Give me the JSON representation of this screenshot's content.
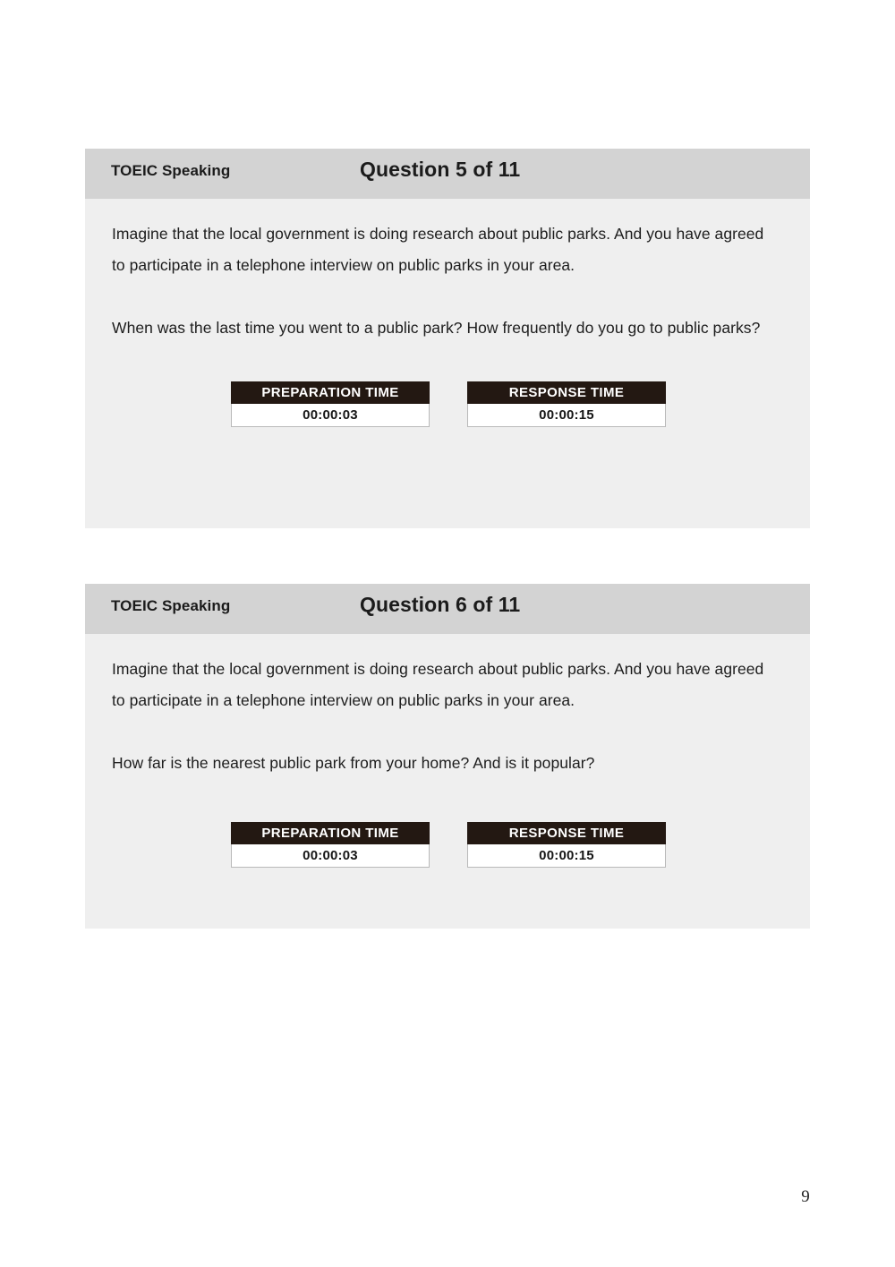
{
  "document": {
    "page_number": "9",
    "background_color": "#ffffff"
  },
  "theme": {
    "panel_background": "#efefef",
    "panel_header_background": "#d3d3d3",
    "timer_header_background": "#231812",
    "timer_value_background": "#ffffff",
    "text_color": "#1d1d1d"
  },
  "panels": [
    {
      "brand": "TOEIC Speaking",
      "title": "Question 5 of 11",
      "intro": "Imagine that the local government is doing research about public parks. And you have agreed to participate in a telephone interview on public parks in your area.",
      "question": "When was the last time you went to a public park? How frequently do you go to public parks?",
      "timers": [
        {
          "label": "PREPARATION TIME",
          "value": "00:00:03"
        },
        {
          "label": "RESPONSE TIME",
          "value": "00:00:15"
        }
      ]
    },
    {
      "brand": "TOEIC Speaking",
      "title": "Question 6 of 11",
      "intro": "Imagine that the local government is doing research about public parks. And you have agreed to participate in a telephone interview on public parks in your area.",
      "question": "How far is the nearest public park from your home? And is it popular?",
      "timers": [
        {
          "label": "PREPARATION TIME",
          "value": "00:00:03"
        },
        {
          "label": "RESPONSE TIME",
          "value": "00:00:15"
        }
      ]
    }
  ]
}
